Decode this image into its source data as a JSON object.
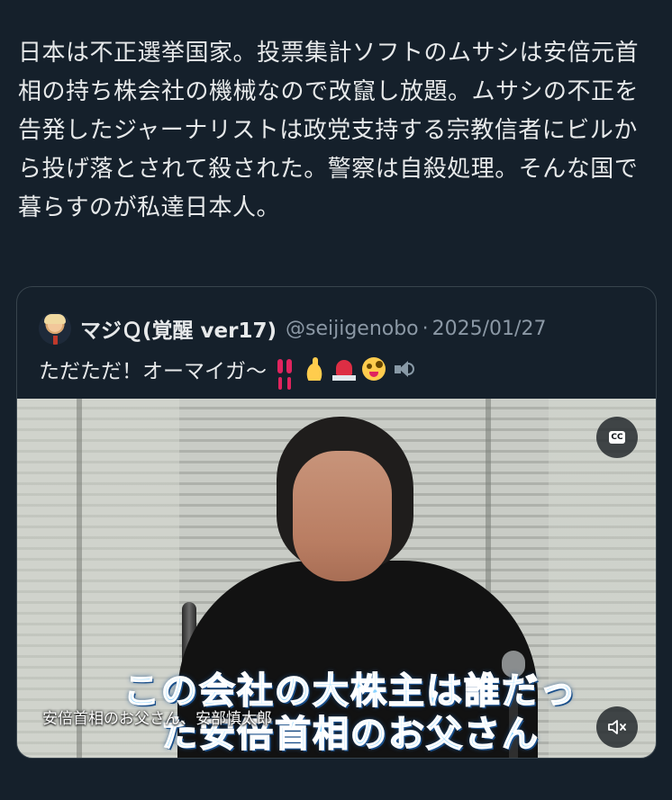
{
  "post": {
    "text": "日本は不正選挙国家。投票集計ソフトのムサシは安倍元首相の持ち株会社の機械なので改竄し放題。ムサシの不正を告発したジャーナリストは政党支持する宗教信者にビルから投げ落とされて殺された。警察は自殺処理。そんな国で暮らすのが私達日本人。"
  },
  "quote": {
    "author_name": "マジＱ(覚醒 ver17)",
    "author_handle": "@seijigenobo",
    "separator": "·",
    "date": "2025/01/27",
    "text": "ただただ！オーマイガ〜",
    "emojis": [
      "double-exclamation-icon",
      "index-finger-up-icon",
      "police-light-icon",
      "zany-face-icon",
      "speaker-icon"
    ],
    "video": {
      "burned_caption_line1": "この会社の大株主は誰だっ",
      "burned_caption_line2": "た安倍首相のお父さん",
      "subtitle": "安倍首相のお父さん、安部慎太郎",
      "cc_label": "CC",
      "cc_button_icon": "closed-captions-icon",
      "mute_button_icon": "speaker-muted-icon"
    }
  },
  "colors": {
    "background": "#15202b",
    "text_primary": "#e7e9ea",
    "text_secondary": "#8b98a5",
    "border": "#38444d"
  }
}
